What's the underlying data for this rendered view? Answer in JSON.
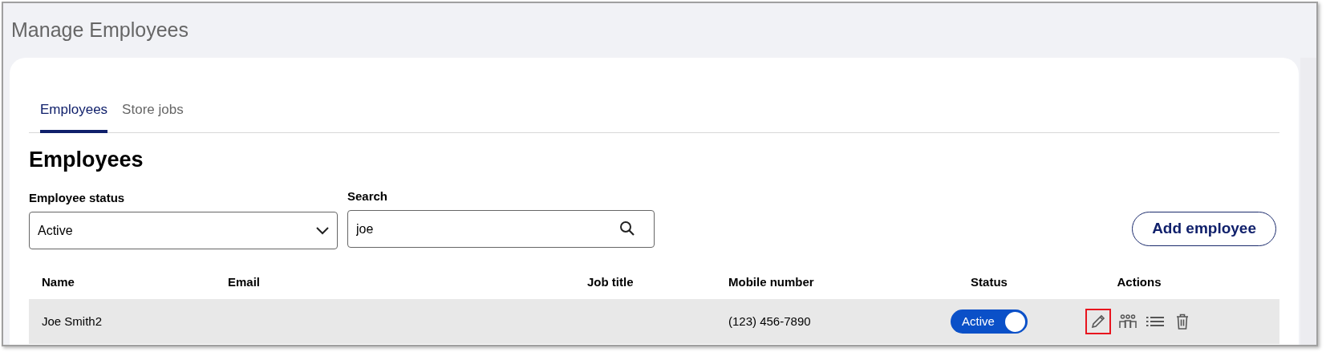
{
  "page_title": "Manage Employees",
  "tabs": [
    {
      "label": "Employees",
      "selected": true
    },
    {
      "label": "Store jobs",
      "selected": false
    }
  ],
  "heading": "Employees",
  "filters": {
    "status": {
      "label": "Employee status",
      "value": "Active"
    },
    "search": {
      "label": "Search",
      "value": "joe"
    }
  },
  "add_button": "Add employee",
  "table": {
    "columns": [
      "Name",
      "Email",
      "Job title",
      "Mobile number",
      "Status",
      "Actions"
    ],
    "rows": [
      {
        "name": "Joe Smith2",
        "email": "",
        "job_title": "",
        "mobile": "(123) 456-7890",
        "status": {
          "label": "Active",
          "on": true
        },
        "edit_highlighted": true
      }
    ]
  }
}
